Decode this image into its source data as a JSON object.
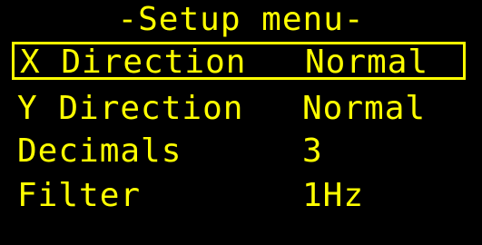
{
  "menu": {
    "title": "-Setup menu-",
    "items": [
      {
        "label": "X Direction",
        "value": "Normal",
        "selected": true
      },
      {
        "label": "Y Direction",
        "value": "Normal",
        "selected": false
      },
      {
        "label": "Decimals",
        "value": "3",
        "selected": false
      },
      {
        "label": "Filter",
        "value": "1Hz",
        "selected": false
      }
    ]
  },
  "colors": {
    "background": "#000000",
    "foreground": "#ffff00"
  }
}
